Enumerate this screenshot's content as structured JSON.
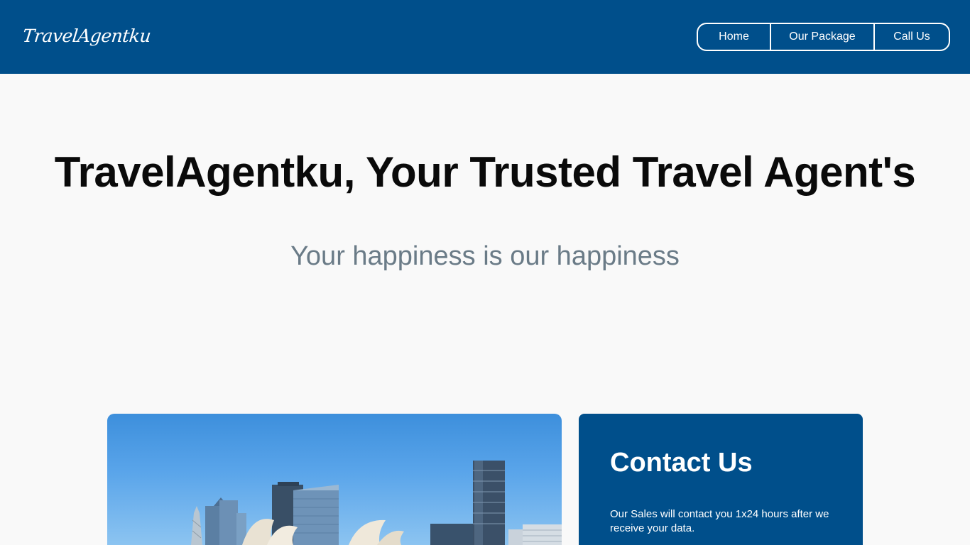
{
  "header": {
    "logo": "TravelAgentku",
    "nav": [
      {
        "label": "Home"
      },
      {
        "label": "Our Package"
      },
      {
        "label": "Call Us"
      }
    ]
  },
  "hero": {
    "title": "TravelAgentku, Your Trusted Travel Agent's",
    "subtitle": "Your happiness is our happiness"
  },
  "contact": {
    "title": "Contact Us",
    "text": "Our Sales will contact you 1x24 hours after we receive your data."
  },
  "colors": {
    "brand": "#004f8b",
    "background": "#f9f9f9",
    "subtitle": "#6a7b87"
  }
}
